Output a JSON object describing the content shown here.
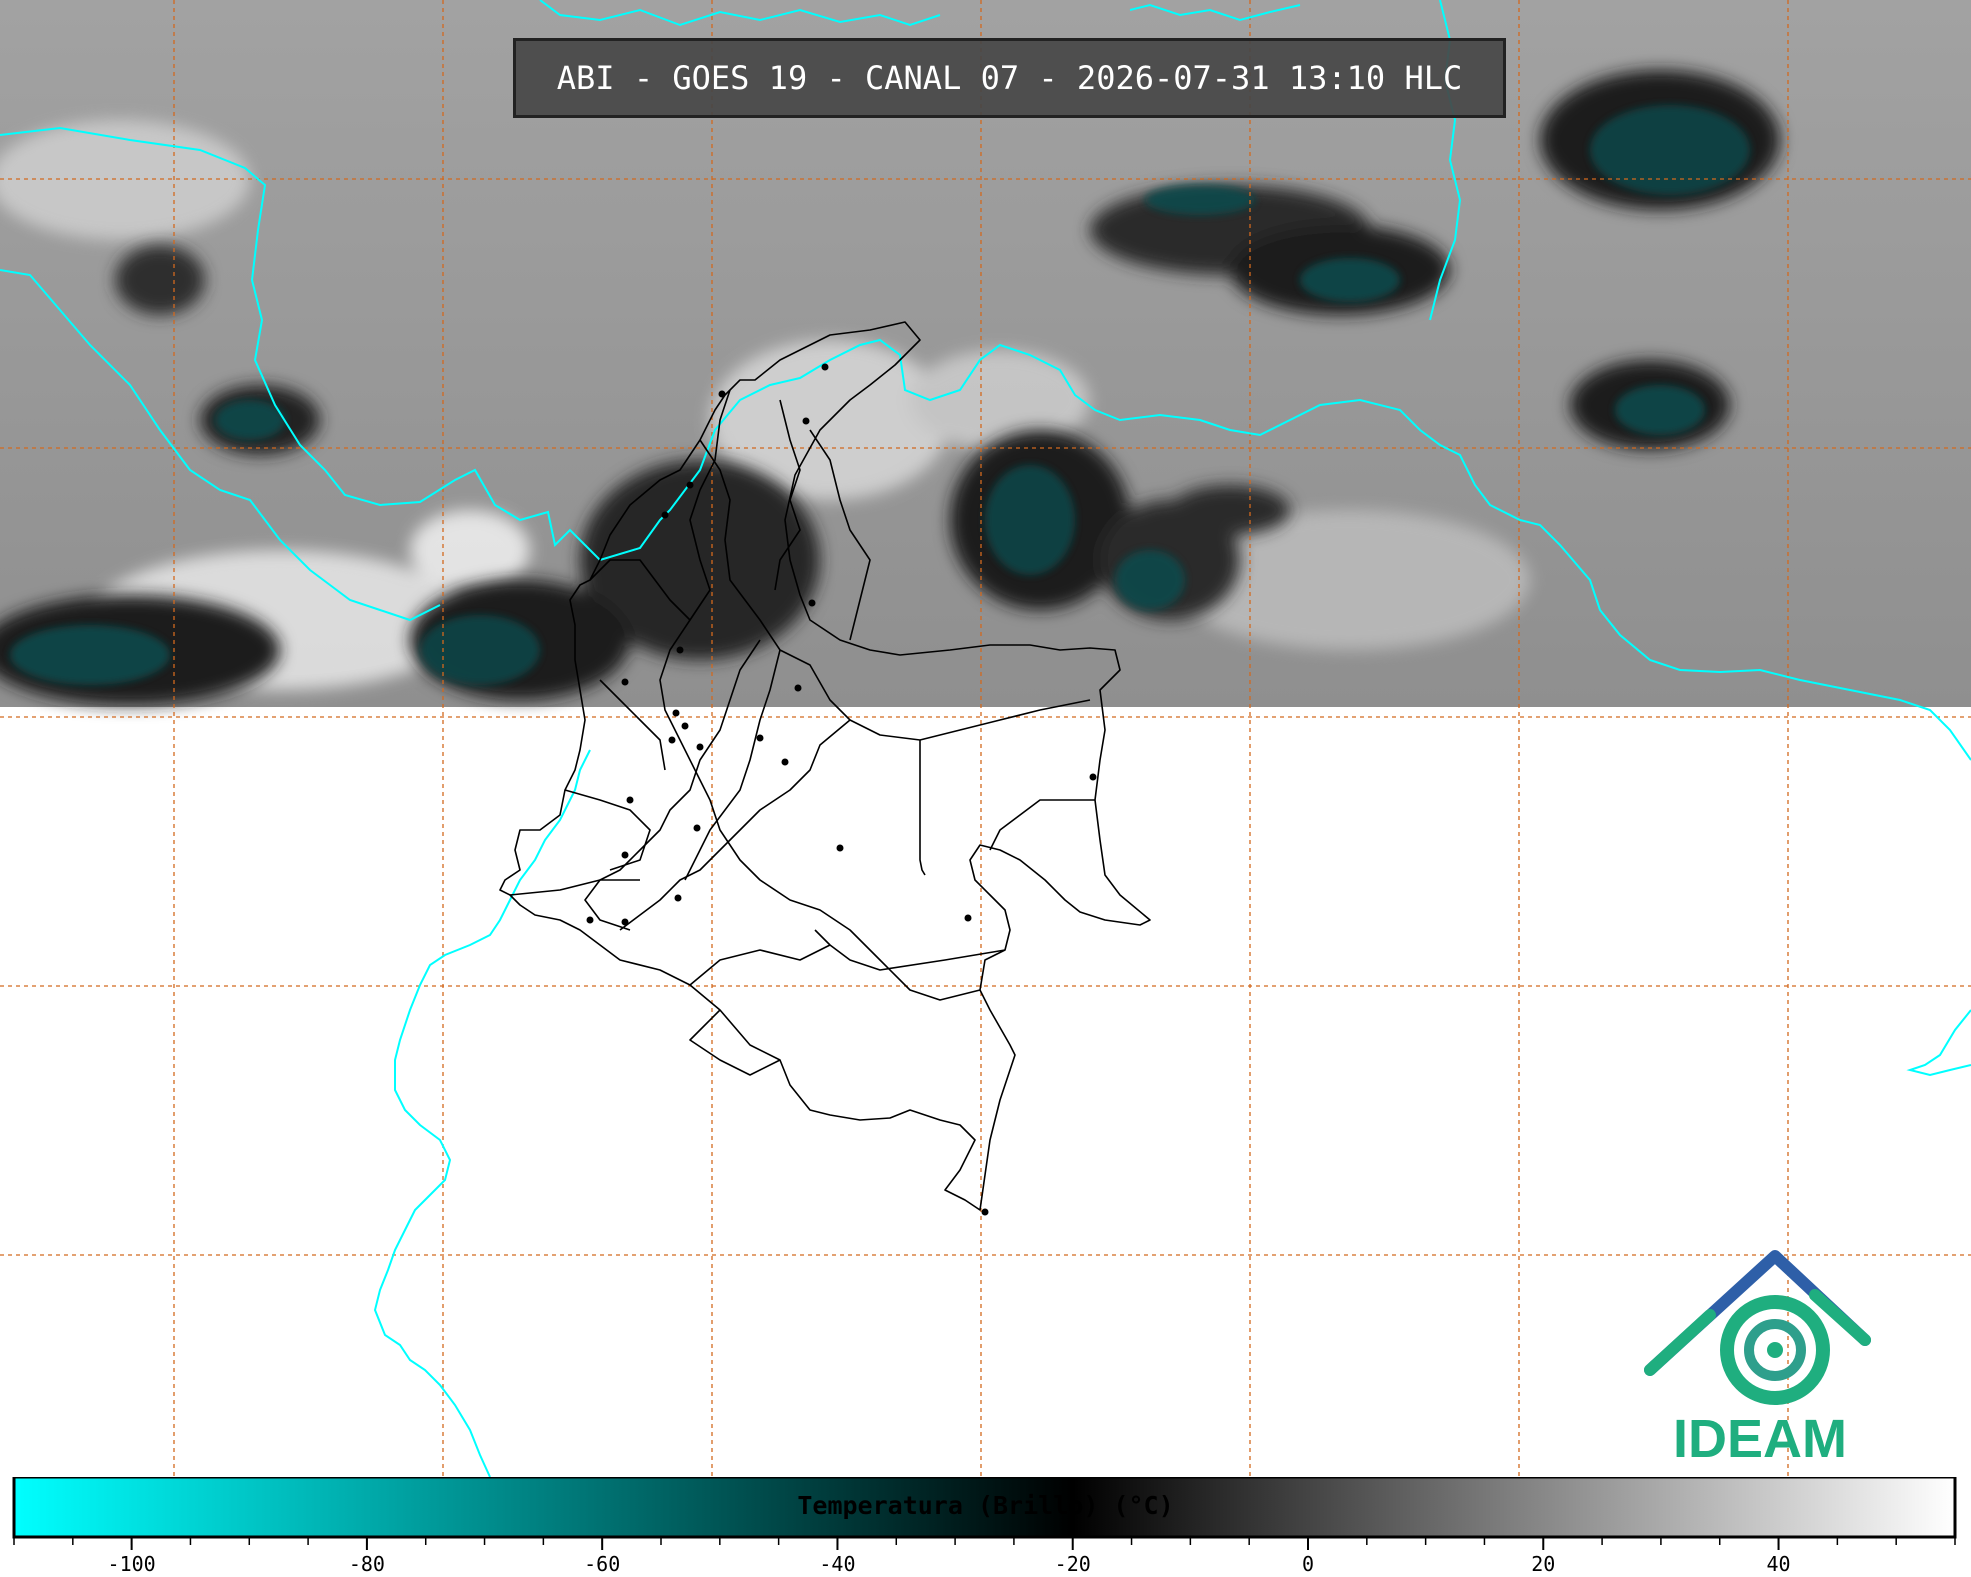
{
  "header": {
    "title": "ABI - GOES 19 - CANAL 07 - 2026-07-31 13:10 HLC"
  },
  "logo": {
    "text": "IDEAM",
    "color": "#1fae7f",
    "roof_color": "#2e5fa8"
  },
  "colorbar": {
    "label": "Temperatura (Brillo) (°C)",
    "min": -110,
    "max": 55,
    "ticks": [
      "-100",
      "-80",
      "-60",
      "-40",
      "-20",
      "0",
      "20",
      "40"
    ],
    "tick_values": [
      -100,
      -80,
      -60,
      -40,
      -20,
      0,
      20,
      40
    ],
    "minor_step": 5,
    "stops": [
      {
        "value": -110,
        "color": "#00ffff"
      },
      {
        "value": -20,
        "color": "#000000"
      },
      {
        "value": 55,
        "color": "#ffffff"
      }
    ]
  },
  "map": {
    "coast_color": "#00ffff",
    "border_color": "#000000",
    "grid_color": "#d2691e",
    "imagery_background": "#9a9a9a"
  }
}
